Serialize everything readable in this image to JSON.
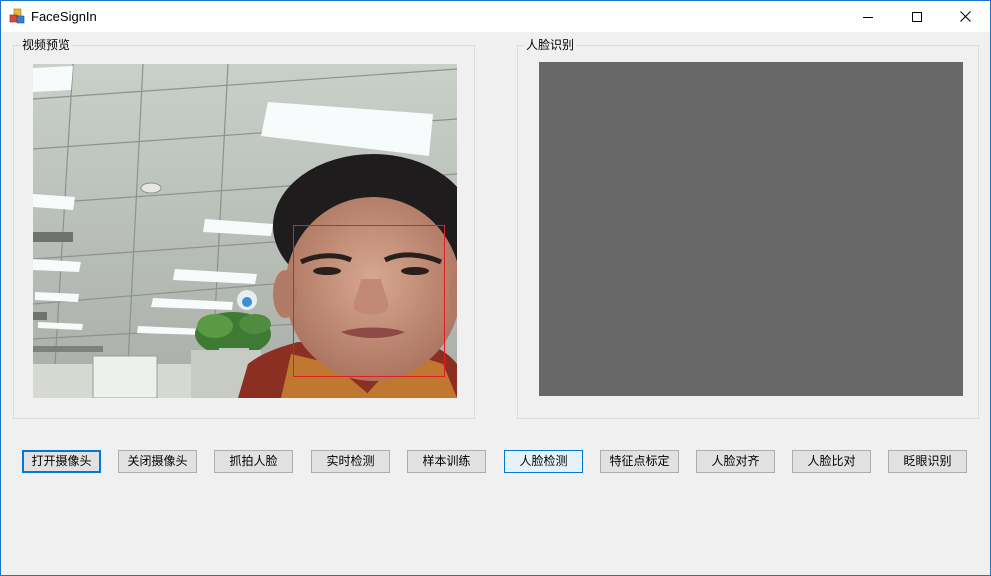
{
  "window": {
    "title": "FaceSignIn",
    "controls": {
      "minimize_icon": "minimize-icon",
      "maximize_icon": "maximize-icon",
      "close_icon": "close-icon"
    }
  },
  "video_preview": {
    "label": "视频预览",
    "face_detected": true
  },
  "face_recognition": {
    "label": "人脸识别",
    "placeholder_color": "#686868"
  },
  "toolbar": {
    "buttons": [
      {
        "label": "打开摄像头",
        "state": "focused"
      },
      {
        "label": "关闭摄像头",
        "state": "normal"
      },
      {
        "label": "抓拍人脸",
        "state": "normal"
      },
      {
        "label": "实时检测",
        "state": "normal"
      },
      {
        "label": "样本训练",
        "state": "normal"
      },
      {
        "label": "人脸检测",
        "state": "hover"
      },
      {
        "label": "特征点标定",
        "state": "normal"
      },
      {
        "label": "人脸对齐",
        "state": "normal"
      },
      {
        "label": "人脸比对",
        "state": "normal"
      },
      {
        "label": "眨眼识别",
        "state": "normal"
      }
    ]
  },
  "colors": {
    "accent": "#0078d7",
    "face_box": "#e02020",
    "window_bg": "#f0f0f0"
  }
}
